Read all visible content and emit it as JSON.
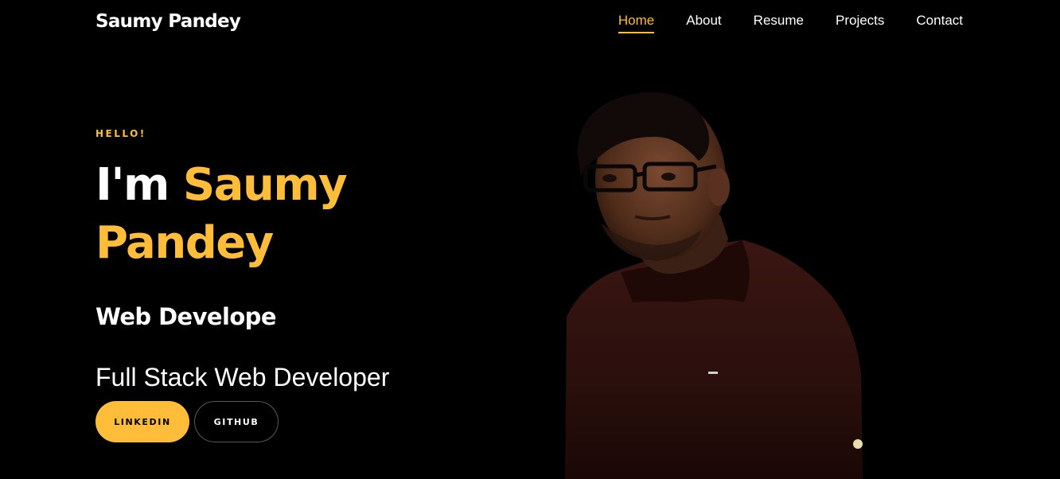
{
  "nav": {
    "brand": "Saumy Pandey",
    "links": [
      {
        "label": "Home",
        "active": true
      },
      {
        "label": "About",
        "active": false
      },
      {
        "label": "Resume",
        "active": false
      },
      {
        "label": "Projects",
        "active": false
      },
      {
        "label": "Contact",
        "active": false
      }
    ]
  },
  "hero": {
    "eyebrow": "HELLO!",
    "greeting": "I'm",
    "first_name": "Saumy",
    "last_name": "Pandey",
    "role": "Web Develope",
    "tagline": "Full Stack Web Developer",
    "buttons": {
      "primary": "LINKEDIN",
      "secondary": "GITHUB"
    },
    "photo_icon": "portrait-photo"
  },
  "colors": {
    "background": "#000000",
    "accent": "#ffbd39",
    "text": "#ffffff"
  }
}
